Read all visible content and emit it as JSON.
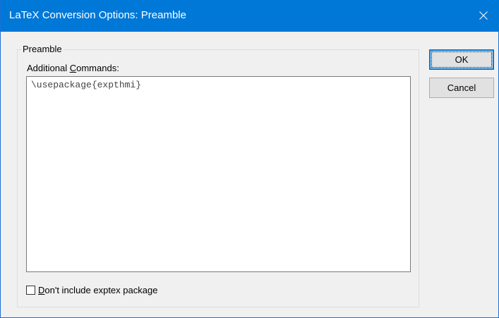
{
  "window": {
    "title": "LaTeX Conversion Options: Preamble",
    "close_icon": "close-icon",
    "accent_color": "#0078d7"
  },
  "preamble_group": {
    "label": "Preamble",
    "commands_label_prefix": "Additional ",
    "commands_label_accel": "C",
    "commands_label_suffix": "ommands:",
    "commands_value": "\\usepackage{expthmi}",
    "checkbox_accel": "D",
    "checkbox_label_rest": "on't include exptex package",
    "checkbox_checked": false
  },
  "buttons": {
    "ok_label": "OK",
    "cancel_label": "Cancel"
  }
}
